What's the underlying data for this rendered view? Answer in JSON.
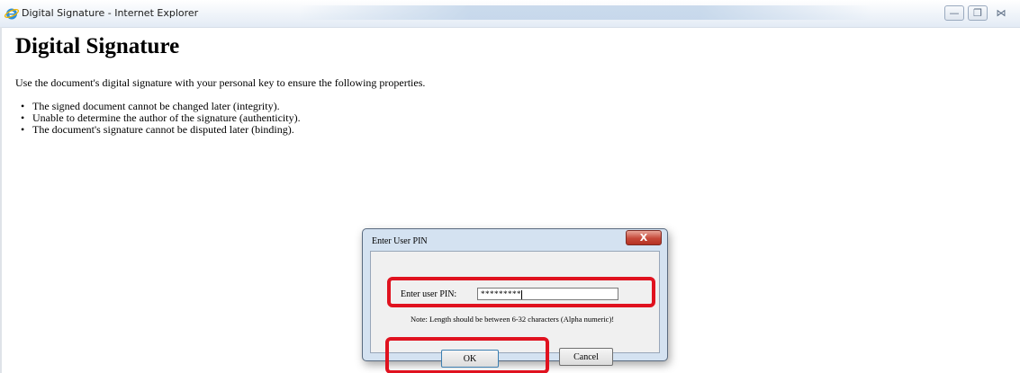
{
  "window": {
    "title": "Digital Signature - Internet Explorer",
    "icon": "internet-explorer-icon",
    "controls": {
      "minimize_icon": "minimize-icon",
      "maximize_icon": "maximize-icon",
      "close_icon": "close-icon"
    }
  },
  "page": {
    "heading": "Digital Signature",
    "intro": "Use the document's digital signature with your personal key to ensure the following properties.",
    "properties": [
      "The signed document cannot be changed later (integrity).",
      "Unable to determine the author of the signature (authenticity).",
      "The document's signature cannot be disputed later (binding)."
    ]
  },
  "dialog": {
    "title": "Enter User PIN",
    "close_label": "X",
    "pin_label": "Enter user PIN:",
    "pin_value": "*********",
    "note": "Note: Length should be between 6-32 characters (Alpha numeric)!",
    "ok_label": "OK",
    "cancel_label": "Cancel"
  },
  "colors": {
    "highlight": "#e0121f",
    "dialog_frame": "#d4e2f1",
    "close_button": "#c6493a"
  }
}
